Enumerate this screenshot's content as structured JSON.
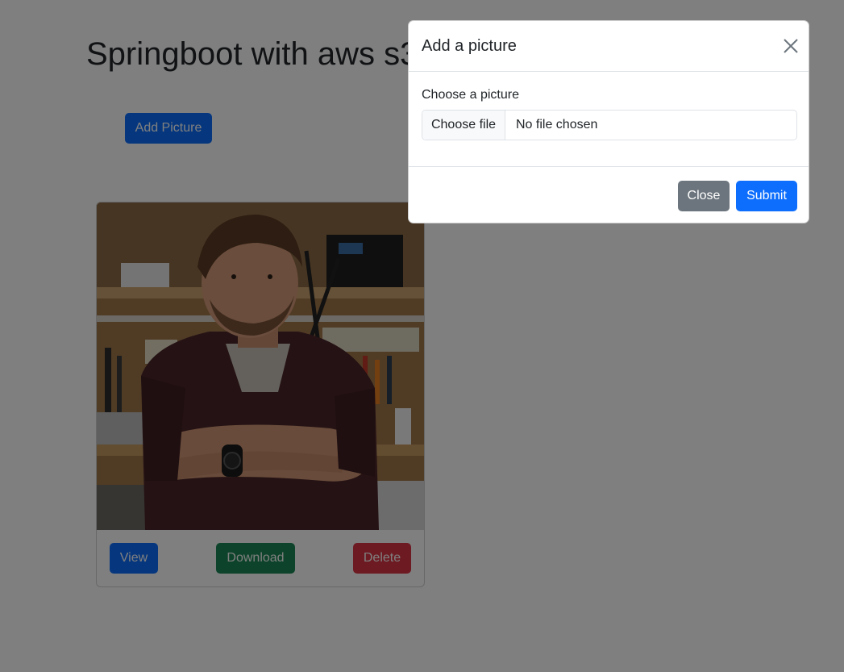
{
  "page": {
    "title": "Springboot with aws s3",
    "add_button_label": "Add Picture"
  },
  "card": {
    "image_alt": "Man with crossed arms in workshop",
    "buttons": {
      "view": "View",
      "download": "Download",
      "delete": "Delete"
    }
  },
  "modal": {
    "title": "Add a picture",
    "field_label": "Choose a picture",
    "file_button_label": "Choose file",
    "file_status": "No file chosen",
    "close_label": "Close",
    "submit_label": "Submit"
  },
  "colors": {
    "primary": "#0d6efd",
    "success": "#198754",
    "danger": "#dc3545",
    "secondary": "#6c757d",
    "backdrop": "rgba(0,0,0,0.5)"
  }
}
